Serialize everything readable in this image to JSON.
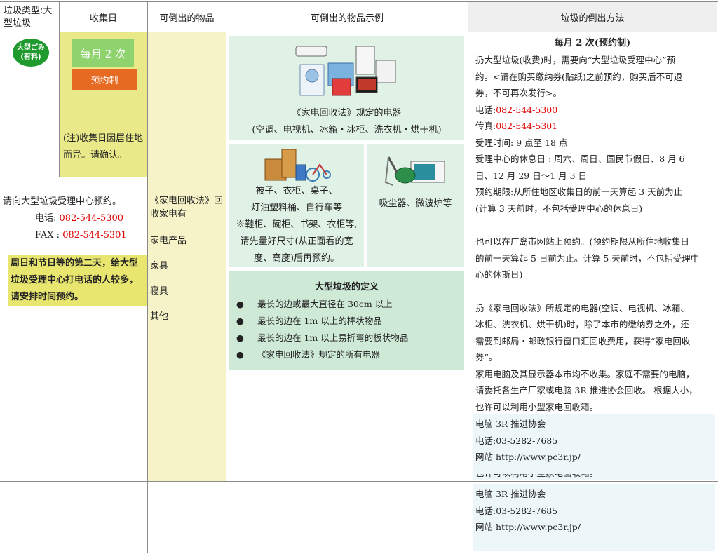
{
  "headers": {
    "type": "垃圾类型:大型垃圾",
    "day": "收集日",
    "items": "可倒出的物品",
    "examples": "可倒出的物品示例",
    "method": "垃圾的倒出方法"
  },
  "category": {
    "badge_line1": "大型ごみ",
    "badge_line2": "(有料)",
    "badge_color": "#1f9a2e"
  },
  "collection": {
    "freq": "每月 2 次",
    "reserve": "预约制",
    "note": "(注)收集日因居住地而异。请确认。"
  },
  "left_info": {
    "intro": "请向大型垃圾受理中心预约。",
    "tel_label": "电话:",
    "tel": "082-544-5300",
    "fax_label": "FAX :",
    "fax": "082-544-5301",
    "warning": "周日和节日等的第二天，给大型垃圾受理中心打电话的人较多，请安排时间预约。"
  },
  "items_list": [
    "《家电回收法》回收家电有",
    "家电产品",
    "家具",
    "寝具",
    "其他"
  ],
  "examples": {
    "appliances_title": "《家电回收法》规定的电器",
    "appliances_list": "(空调、电视机、冰箱・冰柜、洗衣机・烘干机)",
    "furniture_lines": [
      "被子、衣柜、桌子、",
      "灯油塑料桶、自行车等",
      "※鞋柜、碗柜、书架、衣柜等,",
      "请先量好尺寸(从正面看的宽",
      "度、高度)后再预约。"
    ],
    "small": "吸尘器、微波炉等",
    "definition_title": "大型垃圾的定义",
    "definition_items": [
      "最长的边或最大直径在 30cm 以上",
      "最长的边在 1m 以上的棒状物品",
      "最长的边在 1m 以上易折弯的板状物品",
      "《家电回收法》规定的所有电器"
    ]
  },
  "method": {
    "title": "每月 2 次(预约制)",
    "p1": [
      "扔大型垃圾(收费)时，需要向“大型垃圾受理中心”预",
      "约。<请在购买缴纳券(贴纸)之前预约，购买后不可退",
      "券，不可再次发行>。"
    ],
    "tel_label": "电话:",
    "tel": "082-544-5300",
    "fax_label": "传真:",
    "fax": "082-544-5301",
    "hours": "受理时间:  9 点至 18 点",
    "holidays": [
      "受理中心的休息日 :  周六、周日、国民节假日、8 月 6",
      "日、12 月 29 日～1 月 3 日"
    ],
    "deadline": [
      "预约期限:从所住地区收集日的前一天算起 3 天前为止",
      "(计算 3 天前时，不包括受理中心的休息日)"
    ],
    "web": [
      "也可以在广岛市网站上预约。(预约期限从所住地收集日",
      "的前一天算起 5 日前为止。计算 5 天前时，不包括受理中",
      "心的休斯日)"
    ],
    "recycle": [
      "扔《家电回收法》所规定的电器(空调、电视机、冰箱、",
      "冰柜、洗衣机、烘干机)时，除了本市的缴纳券之外，还",
      "需要到邮局・邮政银行窗口汇回收费用，获得“家电回收",
      "券”。"
    ],
    "pc": [
      "家用电脑及其显示器本市均不收集。家庭不需要的电脑，",
      "请委托各生产厂家或电脑 3R 推进协会回收。 根据大小，",
      "也许可以利用小型家电回收箱。"
    ],
    "assoc_name": "电脑 3R 推进协会",
    "assoc_tel": "电话:03-5282-7685",
    "assoc_web": "网站 http://www.pc3r.jp/",
    "cut_off": "也许可以利用小型家电回收箱。"
  },
  "bottom_row": {
    "assoc_name": "电脑 3R 推进协会",
    "assoc_tel": "电话:03-5282-7685",
    "assoc_web": "网站 http://www.pc3r.jp/"
  }
}
